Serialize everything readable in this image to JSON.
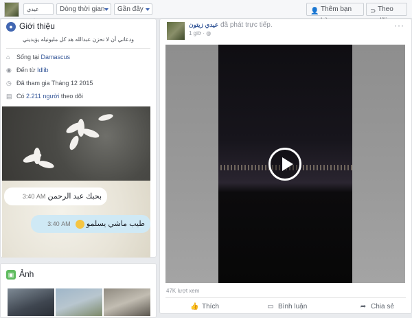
{
  "topbar": {
    "name_chip": "عيدي زيتون",
    "timeline_label": "Dòng thời gian",
    "recent_label": "Gần đây",
    "add_friend_label": "Thêm bạn bè",
    "follow_label": "Theo dõi",
    "add_friend_icon": "add-friend-icon",
    "follow_icon": "rss-icon"
  },
  "intro": {
    "title": "Giới thiệu",
    "icon": "globe-icon",
    "bio": "ودعاني أن لا نحزن عبدالله هد كل مليونيله يؤيديني",
    "rows": [
      {
        "icon": "home-icon",
        "text": "Sống tại ",
        "link": "Damascus"
      },
      {
        "icon": "location-icon",
        "text": "Đến từ ",
        "link": "Idlib"
      },
      {
        "icon": "clock-icon",
        "text": "Đã tham gia Tháng 12 2015",
        "link": ""
      },
      {
        "icon": "rss-icon",
        "text": "Có ",
        "link": "2.211 người",
        "suffix": " theo dõi"
      }
    ]
  },
  "chat": {
    "incoming_text": "بحبك عبد الرحمن",
    "incoming_time": "3:40 AM",
    "outgoing_text": "طيب ماشي يسلمو",
    "outgoing_time": "3:40 AM"
  },
  "photos": {
    "title": "Ảnh",
    "icon": "photo-icon"
  },
  "post": {
    "author": "عيدي زيتون",
    "action": " đã phát trực tiếp.",
    "time": "1 giờ · ",
    "privacy_icon": "globe-icon",
    "views": "47K lượt xem",
    "like_label": "Thích",
    "comment_label": "Bình luận",
    "share_label": "Chia sẻ"
  },
  "colors": {
    "brand": "#4267b2",
    "link": "#365899",
    "background": "#e9ebee"
  }
}
